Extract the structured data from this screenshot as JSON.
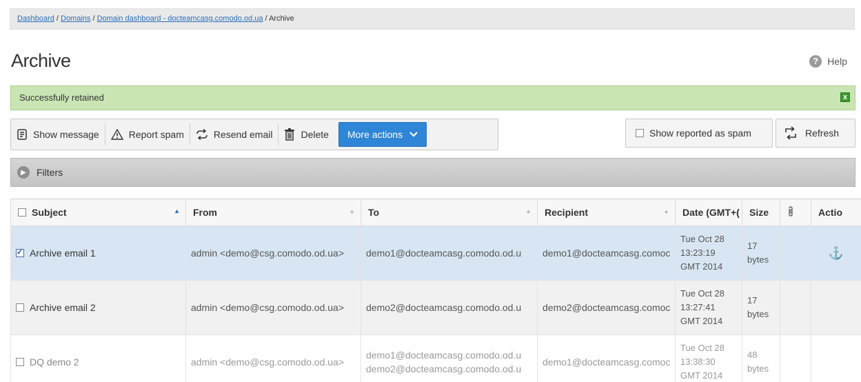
{
  "breadcrumb": {
    "items": [
      "Dashboard",
      "Domains",
      "Domain dashboard - docteamcasg.comodo.od.ua"
    ],
    "current": "Archive",
    "separator": " / "
  },
  "page": {
    "title": "Archive",
    "help_label": "Help"
  },
  "alert": {
    "message": "Successfully retained",
    "close_label": "x"
  },
  "toolbar": {
    "show_message": "Show message",
    "report_spam": "Report spam",
    "resend_email": "Resend email",
    "delete": "Delete",
    "more_actions": "More actions",
    "show_reported_spam": "Show reported as spam",
    "refresh": "Refresh"
  },
  "filters": {
    "label": "Filters"
  },
  "table": {
    "columns": [
      "Subject",
      "From",
      "To",
      "Recipient",
      "Date (GMT+(",
      "Size",
      "",
      "Actio"
    ],
    "rows": [
      {
        "checked": true,
        "subject": "Archive email 1",
        "from": "admin <demo@csg.comodo.od.ua>",
        "to": [
          "demo1@docteamcasg.comodo.od.u"
        ],
        "recipient": "demo1@docteamcasg.comoc",
        "date": "Tue Oct 28 13:23:19 GMT 2014",
        "size": "17 bytes",
        "action_icon": "anchor-icon"
      },
      {
        "checked": false,
        "subject": "Archive email 2",
        "from": "admin <demo@csg.comodo.od.ua>",
        "to": [
          "demo2@docteamcasg.comodo.od.u"
        ],
        "recipient": "demo2@docteamcasg.comoc",
        "date": "Tue Oct 28 13:27:41 GMT 2014",
        "size": "17 bytes",
        "action_icon": ""
      },
      {
        "checked": false,
        "subject": "DQ demo 2",
        "from": "admin <demo@csg.comodo.od.ua>",
        "to": [
          "demo1@docteamcasg.comodo.od.u",
          "demo2@docteamcasg.comodo.od.u"
        ],
        "recipient": "demo1@docteamcasg.comoc",
        "date": "Tue Oct 28 13:38:30 GMT 2014",
        "size": "48 bytes",
        "action_icon": ""
      }
    ]
  }
}
